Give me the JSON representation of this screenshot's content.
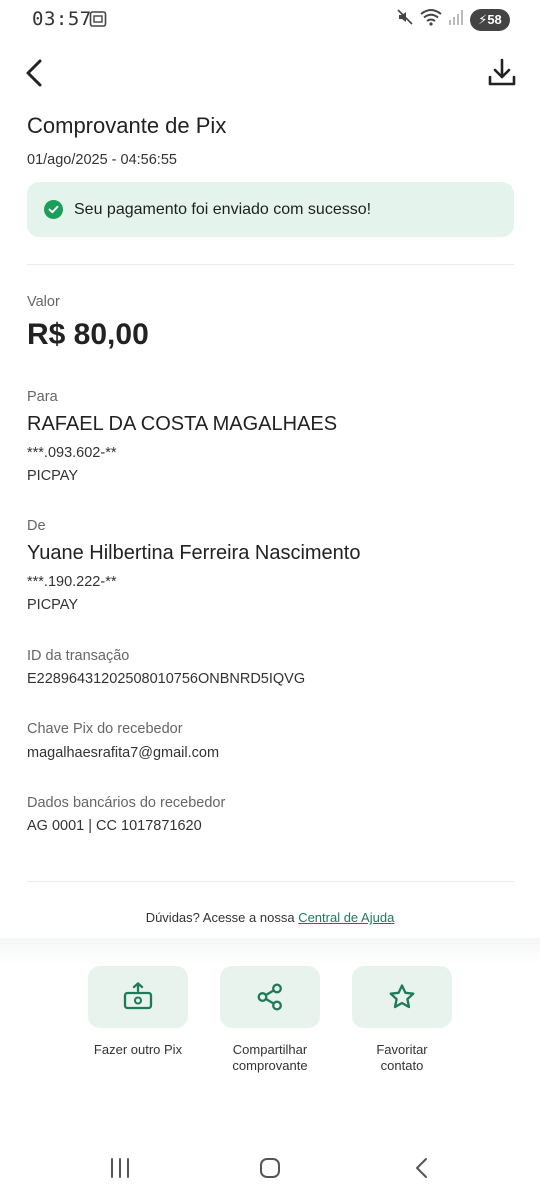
{
  "status_bar": {
    "time": "03:57",
    "battery": "58"
  },
  "header": {
    "back_icon": "chevron-left-icon",
    "download_icon": "download-icon"
  },
  "receipt": {
    "title": "Comprovante de Pix",
    "datetime": "01/ago/2025 - 04:56:55",
    "success_message": "Seu pagamento foi enviado com sucesso!",
    "value_label": "Valor",
    "value": "R$ 80,00",
    "to_label": "Para",
    "to_name": "RAFAEL DA COSTA MAGALHAES",
    "to_doc": "***.093.602-**",
    "to_bank": "PICPAY",
    "from_label": "De",
    "from_name": "Yuane Hilbertina Ferreira Nascimento",
    "from_doc": "***.190.222-**",
    "from_bank": "PICPAY",
    "transaction_label": "ID da transação",
    "transaction_id": "E22896431202508010756ONBNRD5IQVG",
    "pix_key_label": "Chave Pix do recebedor",
    "pix_key": "magalhaesrafita7@gmail.com",
    "bank_data_label": "Dados bancários do recebedor",
    "bank_data": "AG 0001 | CC 1017871620"
  },
  "help": {
    "text": "Dúvidas? Acesse a nossa",
    "link": "Central de Ajuda"
  },
  "actions": [
    {
      "label_line1": "Fazer outro Pix",
      "label_line2": "",
      "icon": "money-send-icon"
    },
    {
      "label_line1": "Compartilhar",
      "label_line2": "comprovante",
      "icon": "share-icon"
    },
    {
      "label_line1": "Favoritar",
      "label_line2": "contato",
      "icon": "star-icon"
    }
  ],
  "colors": {
    "accent": "#1e7a5b",
    "success": "#1b9e5a",
    "success_bg": "#e4f4ec",
    "tile_bg": "#e8f3ee"
  }
}
